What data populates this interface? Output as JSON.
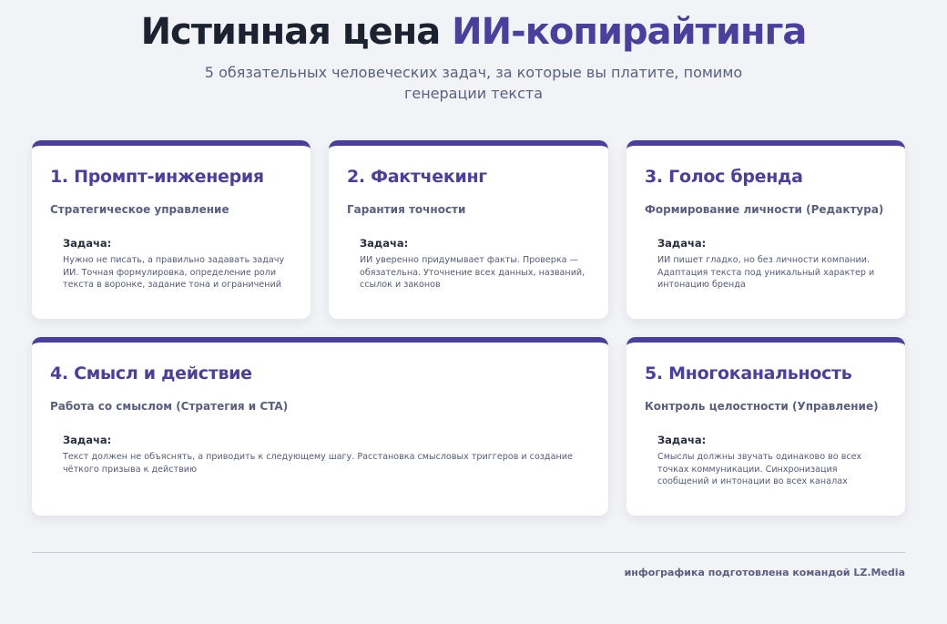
{
  "header": {
    "title_plain": "Истинная цена ",
    "title_accent": "ИИ-копирайтинга",
    "subtitle": "5 обязательных человеческих задач, за которые вы платите, помимо генерации текста"
  },
  "cards": [
    {
      "title": "1. Промпт-инженерия",
      "subtitle": "Стратегическое управление",
      "task_label": "Задача:",
      "task_text": "Нужно не писать, а правильно задавать задачу ИИ. Точная формулировка, определение роли текста в воронке, задание тона и ограничений"
    },
    {
      "title": "2. Фактчекинг",
      "subtitle": "Гарантия точности",
      "task_label": "Задача:",
      "task_text": "ИИ уверенно придумывает факты. Проверка — обязательна. Уточнение всех данных, названий, ссылок и законов"
    },
    {
      "title": "3. Голос бренда",
      "subtitle": "Формирование личности (Редактура)",
      "task_label": "Задача:",
      "task_text": "ИИ пишет гладко, но без личности компании. Адаптация текста под уникальный характер и интонацию бренда"
    },
    {
      "title": "4. Смысл и действие",
      "subtitle": "Работа со смыслом (Стратегия и CTA)",
      "task_label": "Задача:",
      "task_text": "Текст должен не объяснять, а приводить к следующему шагу. Расстановка смысловых триггеров и создание чёткого призыва к действию"
    },
    {
      "title": "5. Многоканальность",
      "subtitle": "Контроль целостности (Управление)",
      "task_label": "Задача:",
      "task_text": "Смыслы должны звучать одинаково во всех точках коммуникации. Синхронизация сообщений и интонации во всех каналах"
    }
  ],
  "footer": {
    "credit": "инфографика подготовлена командой LZ.Media"
  },
  "colors": {
    "accent": "#4b3f9e",
    "background": "#f2f3f6",
    "card": "#ffffff"
  }
}
